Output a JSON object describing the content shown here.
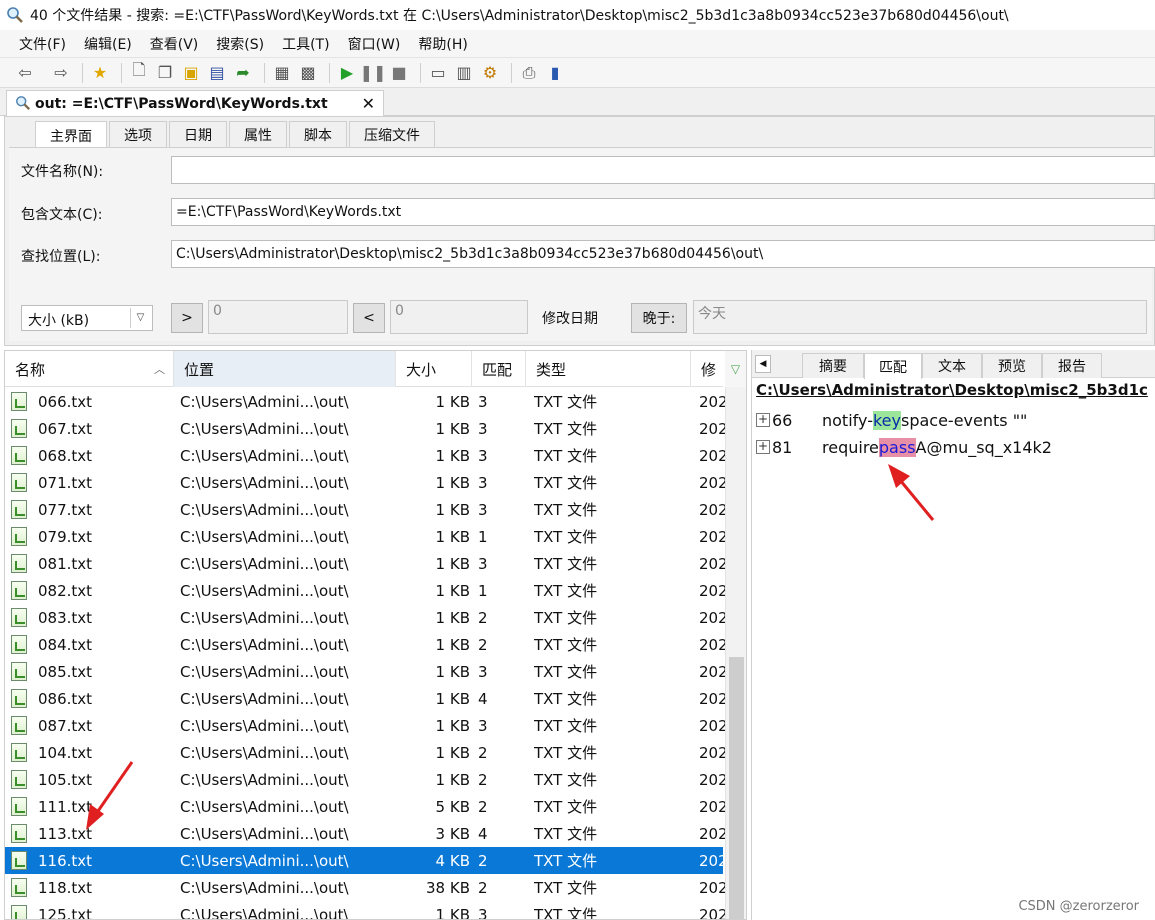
{
  "window": {
    "title": "40 个文件结果 - 搜索: =E:\\CTF\\PassWord\\KeyWords.txt 在 C:\\Users\\Administrator\\Desktop\\misc2_5b3d1c3a8b0934cc523e37b680d04456\\out\\"
  },
  "menu": [
    "文件(F)",
    "编辑(E)",
    "查看(V)",
    "搜索(S)",
    "工具(T)",
    "窗口(W)",
    "帮助(H)"
  ],
  "doc_tab": {
    "label": "out: =E:\\CTF\\PassWord\\KeyWords.txt",
    "close": "✕"
  },
  "search_tabs": [
    "主界面",
    "选项",
    "日期",
    "属性",
    "脚本",
    "压缩文件"
  ],
  "form": {
    "filename_label": "文件名称(N):",
    "filename_value": "",
    "contains_label": "包含文本(C):",
    "contains_value": "=E:\\CTF\\PassWord\\KeyWords.txt",
    "location_label": "查找位置(L):",
    "location_value": "C:\\Users\\Administrator\\Desktop\\misc2_5b3d1c3a8b0934cc523e37b680d04456\\out\\",
    "size_unit": "大小 (kB)",
    "gt_button": ">",
    "gt_value": "0",
    "lt_button": "<",
    "lt_value": "0",
    "modified_label": "修改日期",
    "later_button": "晚于:",
    "date_value": "今天"
  },
  "columns": [
    "名称",
    "位置",
    "大小",
    "匹配",
    "类型",
    "修"
  ],
  "rows": [
    {
      "name": "066.txt",
      "location": "C:\\Users\\Admini...\\out\\",
      "size": "1 KB",
      "matches": "3",
      "type": "TXT 文件",
      "modified": "202"
    },
    {
      "name": "067.txt",
      "location": "C:\\Users\\Admini...\\out\\",
      "size": "1 KB",
      "matches": "3",
      "type": "TXT 文件",
      "modified": "202"
    },
    {
      "name": "068.txt",
      "location": "C:\\Users\\Admini...\\out\\",
      "size": "1 KB",
      "matches": "3",
      "type": "TXT 文件",
      "modified": "202"
    },
    {
      "name": "071.txt",
      "location": "C:\\Users\\Admini...\\out\\",
      "size": "1 KB",
      "matches": "3",
      "type": "TXT 文件",
      "modified": "202"
    },
    {
      "name": "077.txt",
      "location": "C:\\Users\\Admini...\\out\\",
      "size": "1 KB",
      "matches": "3",
      "type": "TXT 文件",
      "modified": "202"
    },
    {
      "name": "079.txt",
      "location": "C:\\Users\\Admini...\\out\\",
      "size": "1 KB",
      "matches": "1",
      "type": "TXT 文件",
      "modified": "202"
    },
    {
      "name": "081.txt",
      "location": "C:\\Users\\Admini...\\out\\",
      "size": "1 KB",
      "matches": "3",
      "type": "TXT 文件",
      "modified": "202"
    },
    {
      "name": "082.txt",
      "location": "C:\\Users\\Admini...\\out\\",
      "size": "1 KB",
      "matches": "1",
      "type": "TXT 文件",
      "modified": "202"
    },
    {
      "name": "083.txt",
      "location": "C:\\Users\\Admini...\\out\\",
      "size": "1 KB",
      "matches": "2",
      "type": "TXT 文件",
      "modified": "202"
    },
    {
      "name": "084.txt",
      "location": "C:\\Users\\Admini...\\out\\",
      "size": "1 KB",
      "matches": "2",
      "type": "TXT 文件",
      "modified": "202"
    },
    {
      "name": "085.txt",
      "location": "C:\\Users\\Admini...\\out\\",
      "size": "1 KB",
      "matches": "3",
      "type": "TXT 文件",
      "modified": "202"
    },
    {
      "name": "086.txt",
      "location": "C:\\Users\\Admini...\\out\\",
      "size": "1 KB",
      "matches": "4",
      "type": "TXT 文件",
      "modified": "202"
    },
    {
      "name": "087.txt",
      "location": "C:\\Users\\Admini...\\out\\",
      "size": "1 KB",
      "matches": "3",
      "type": "TXT 文件",
      "modified": "202"
    },
    {
      "name": "104.txt",
      "location": "C:\\Users\\Admini...\\out\\",
      "size": "1 KB",
      "matches": "2",
      "type": "TXT 文件",
      "modified": "202"
    },
    {
      "name": "105.txt",
      "location": "C:\\Users\\Admini...\\out\\",
      "size": "1 KB",
      "matches": "2",
      "type": "TXT 文件",
      "modified": "202"
    },
    {
      "name": "111.txt",
      "location": "C:\\Users\\Admini...\\out\\",
      "size": "5 KB",
      "matches": "2",
      "type": "TXT 文件",
      "modified": "202"
    },
    {
      "name": "113.txt",
      "location": "C:\\Users\\Admini...\\out\\",
      "size": "3 KB",
      "matches": "4",
      "type": "TXT 文件",
      "modified": "202"
    },
    {
      "name": "116.txt",
      "location": "C:\\Users\\Admini...\\out\\",
      "size": "4 KB",
      "matches": "2",
      "type": "TXT 文件",
      "modified": "202",
      "selected": true
    },
    {
      "name": "118.txt",
      "location": "C:\\Users\\Admini...\\out\\",
      "size": "38 KB",
      "matches": "2",
      "type": "TXT 文件",
      "modified": "202"
    },
    {
      "name": "125.txt",
      "location": "C:\\Users\\Admini...\\out\\",
      "size": "1 KB",
      "matches": "3",
      "type": "TXT 文件",
      "modified": "202"
    }
  ],
  "preview": {
    "collapse": "◀",
    "tabs": [
      "摘要",
      "匹配",
      "文本",
      "预览",
      "报告"
    ],
    "active_tab": "匹配",
    "path": "C:\\Users\\Administrator\\Desktop\\misc2_5b3d1c",
    "matches": [
      {
        "line": "66",
        "before": "notify-",
        "hit": "key",
        "after": "space-events \"\""
      },
      {
        "line": "81",
        "before": "require",
        "hit": "pass",
        "after": " A@mu_sq_x14k2"
      }
    ]
  },
  "watermark": "CSDN @zerorzeror",
  "colors": {
    "selection": "#0a78d7",
    "key_highlight": "#9be69b",
    "pass_highlight": "#e88fa8",
    "arrow": "#e02020"
  }
}
